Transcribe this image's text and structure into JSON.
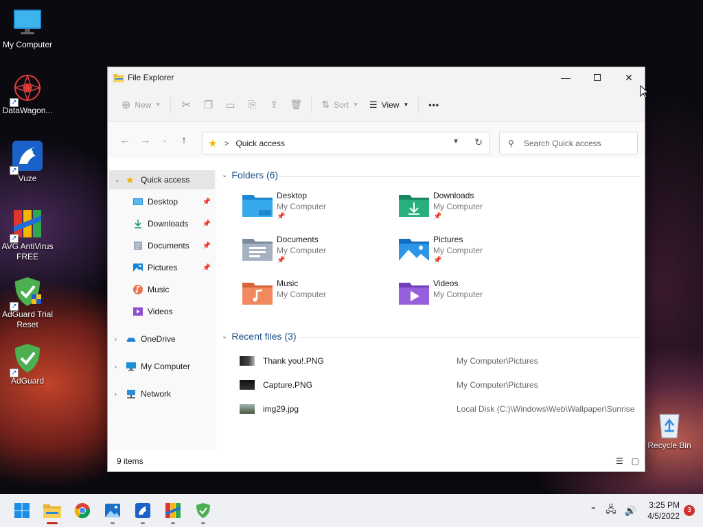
{
  "desktop": {
    "icons": [
      {
        "label": "My Computer",
        "icon": "monitor-icon"
      },
      {
        "label": "DataWagon...",
        "icon": "datawagon-icon"
      },
      {
        "label": "Vuze",
        "icon": "vuze-frog-icon"
      },
      {
        "label": "AVG AntiVirus FREE",
        "icon": "avg-icon"
      },
      {
        "label": "AdGuard Trial Reset",
        "icon": "adguard-shield-icon"
      },
      {
        "label": "AdGuard",
        "icon": "adguard-shield-icon"
      },
      {
        "label": "Recycle Bin",
        "icon": "recycle-bin-icon"
      }
    ]
  },
  "window": {
    "title": "File Explorer",
    "toolbar": {
      "new_label": "New",
      "sort_label": "Sort",
      "view_label": "View",
      "more_label": "•••"
    },
    "address": {
      "path": "Quick access",
      "separator": ">"
    },
    "search": {
      "placeholder": "Search Quick access"
    },
    "sidebar": {
      "quick_access": "Quick access",
      "pinned": [
        {
          "label": "Desktop",
          "pinned": true
        },
        {
          "label": "Downloads",
          "pinned": true
        },
        {
          "label": "Documents",
          "pinned": true
        },
        {
          "label": "Pictures",
          "pinned": true
        },
        {
          "label": "Music",
          "pinned": false
        },
        {
          "label": "Videos",
          "pinned": false
        }
      ],
      "roots": [
        "OneDrive",
        "My Computer",
        "Network"
      ]
    },
    "folders_header": "Folders (6)",
    "folders": [
      {
        "name": "Desktop",
        "location": "My Computer",
        "pinned": true
      },
      {
        "name": "Downloads",
        "location": "My Computer",
        "pinned": true
      },
      {
        "name": "Documents",
        "location": "My Computer",
        "pinned": true
      },
      {
        "name": "Pictures",
        "location": "My Computer",
        "pinned": true
      },
      {
        "name": "Music",
        "location": "My Computer",
        "pinned": false
      },
      {
        "name": "Videos",
        "location": "My Computer",
        "pinned": false
      }
    ],
    "recent_header": "Recent files (3)",
    "recent": [
      {
        "name": "Thank you!.PNG",
        "path": "My Computer\\Pictures"
      },
      {
        "name": "Capture.PNG",
        "path": "My Computer\\Pictures"
      },
      {
        "name": "img29.jpg",
        "path": "Local Disk (C:)\\Windows\\Web\\Wallpaper\\Sunrise"
      }
    ],
    "status": "9 items"
  },
  "taskbar": {
    "time": "3:25 PM",
    "date": "4/5/2022",
    "notification_count": "3"
  },
  "colors": {
    "accent": "#0067c0",
    "folder_yellow": "#f0c23b",
    "section_blue": "#1a4f8a"
  }
}
